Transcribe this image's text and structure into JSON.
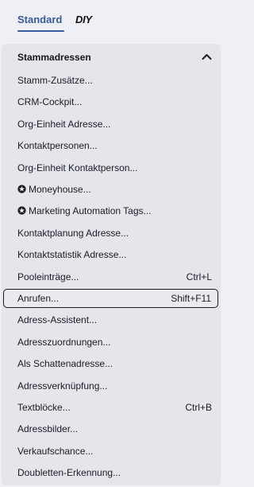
{
  "tabs": {
    "standard": "Standard",
    "diy": "DIY"
  },
  "menu": {
    "header": "Stammadressen",
    "header_icon": "chevron-up-icon",
    "items": [
      {
        "label": "Stamm-Zusätze...",
        "shortcut": ""
      },
      {
        "label": "CRM-Cockpit...",
        "shortcut": ""
      },
      {
        "label": "Org-Einheit Adresse...",
        "shortcut": ""
      },
      {
        "label": "Kontaktpersonen...",
        "shortcut": ""
      },
      {
        "label": "Org-Einheit Kontaktperson...",
        "shortcut": ""
      },
      {
        "label": "Moneyhouse...",
        "shortcut": "",
        "icon": "star-badge-icon"
      },
      {
        "label": "Marketing Automation Tags...",
        "shortcut": "",
        "icon": "star-badge-icon"
      },
      {
        "label": "Kontaktplanung Adresse...",
        "shortcut": ""
      },
      {
        "label": "Kontaktstatistik Adresse...",
        "shortcut": ""
      },
      {
        "label": "Pooleinträge...",
        "shortcut": "Ctrl+L"
      },
      {
        "label": "Anrufen...",
        "shortcut": "Shift+F11",
        "selected": true
      },
      {
        "label": "Adress-Assistent...",
        "shortcut": ""
      },
      {
        "label": "Adresszuordnungen...",
        "shortcut": ""
      },
      {
        "label": "Als Schattenadresse...",
        "shortcut": ""
      },
      {
        "label": "Adressverknüpfung...",
        "shortcut": ""
      },
      {
        "label": "Textblöcke...",
        "shortcut": "Ctrl+B"
      },
      {
        "label": "Adressbilder...",
        "shortcut": ""
      },
      {
        "label": "Verkaufschance...",
        "shortcut": ""
      },
      {
        "label": "Doubletten-Erkennung...",
        "shortcut": ""
      }
    ]
  },
  "colors": {
    "accent": "#3a5a9e",
    "background": "#eef0f5",
    "menu_background": "#e4e6ec",
    "text": "#1c1c24"
  }
}
